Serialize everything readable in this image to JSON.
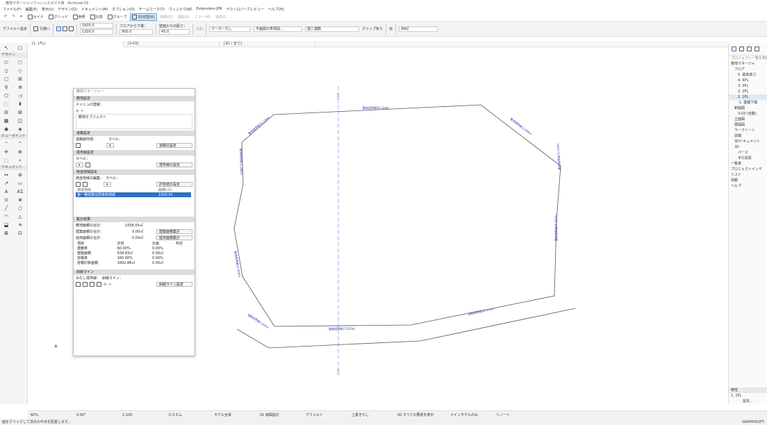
{
  "window": {
    "title": "敷地マネージャリファレンスガイド用 - Archicad 29"
  },
  "menu": [
    "ファイル(F)",
    "編集(E)",
    "表示(V)",
    "デザイン(D)",
    "ドキュメント(M)",
    "オプション(O)",
    "チームワーク(T)",
    "ウィンドウ(W)",
    "Extensions JPN",
    "テクノロジープレビュー",
    "ヘルプ(H)"
  ],
  "toolbar": {
    "guide": "ガイド",
    "grid": "グリッド",
    "ref": "参照",
    "calc": "計測",
    "group": "グループ",
    "view_mode": "3D切替(K)",
    "move": "移動(D)",
    "rotate": "回転(R)",
    "mirror": "ミラー(M)",
    "recall": "逆順ダ...",
    "items": [
      "↶",
      "↷",
      "✦"
    ]
  },
  "infobox": {
    "default": "デフォルト設定",
    "draw": "引渡い",
    "h1": "1600.0",
    "h2": "1200.0",
    "floor_from": "フロアから下端：",
    "floor_val": "900.0",
    "wall_from": "壁面からの距さ：",
    "wall_val": "45.0",
    "reverse": "反転",
    "marker": "マーカーなし",
    "plane": "平面図の表現図...",
    "wall_link": "壁に連動",
    "clip": "クリップ有り",
    "glass": "窓",
    "aw": "AW2"
  },
  "tabs": [
    "[1. 1FL]",
    "[3-03]",
    "[3D / 全て]"
  ],
  "toolbox": {
    "section_design": "デザイン",
    "section_viewpoint": "ビューポイント",
    "section_document": "ドキュメント",
    "design_icons": [
      "⬭",
      "⬡",
      "▯",
      "◇",
      "▢",
      "⊞",
      "⚲",
      "✲",
      "⬠",
      "◁",
      "⬚",
      "⬍",
      "⊟",
      "⊞",
      "▦",
      "◫",
      "◉",
      "◈"
    ],
    "viewpoint_icons": [
      "⌃",
      "⌃",
      "✢",
      "⊕",
      "⬚",
      "⌕"
    ],
    "document_icons": [
      "↔",
      "⊛",
      "↗",
      "▭",
      "A",
      "A1",
      "⊙",
      "⊗",
      "╱",
      "○",
      "◠",
      "△",
      "⬓",
      "✳",
      "⊠",
      "⊡"
    ]
  },
  "right_panel": {
    "project_label": "プロジェクト一覧を検索",
    "items": [
      "敷地マネージャ",
      "フロア",
      "5. 最高高さ",
      "4. RFL",
      "3. 3FL",
      "2. 2FL",
      "1. 1FL",
      "-1. 基礎下端",
      "断面図",
      "3-03 (自動)",
      "立面図",
      "展開図",
      "ワークシート",
      "詳細",
      "3Dドキュメント",
      "3D",
      "パース",
      "平行投影",
      "一覧表",
      "プロジェクトインデ",
      "リスト",
      "情報",
      "ヘルプ"
    ],
    "selected_index": 6,
    "bottom_floor": "1.  1FL",
    "settings": "設定...",
    "properties": "特性"
  },
  "palette": {
    "title": "敷地マネージャー",
    "s_site": "敷地設定",
    "mesh_label": "メッシュの登録：",
    "site_object": "敷地オブジェクト",
    "s_road": "道路設定",
    "road_create": "道路線作成：",
    "label_text": "ラベル：",
    "road_settings": "道路の設定",
    "s_boundary": "境界線設定",
    "boundary_settings": "境界線の設定",
    "s_zone": "用途地域設定",
    "zone_edit": "用途地域の編集：",
    "permit_settings": "許容値の設定",
    "zone_cols": [
      "用途地域",
      "面積(㎡)"
    ],
    "zone_row": [
      "第一種低層住居専用地域",
      "1058.05"
    ],
    "s_calc": "集計結果",
    "site_area_label": "敷地面積の合計：",
    "site_area": "1058.05㎡",
    "building_area_label": "建築面積の合計：",
    "building_area": "0.00㎡",
    "building_area_btn": "建築面積集計",
    "floor_area_label": "延床面積の合計：",
    "floor_area": "0.00㎡",
    "floor_area_btn": "延床面積集計",
    "table_head": [
      "項目",
      "許容",
      "計画",
      "判定"
    ],
    "table_rows": [
      [
        "建蔽率",
        "60.00%",
        "0.00%",
        ""
      ],
      [
        "建築面積",
        "634.83㎡",
        "0.00㎡",
        ""
      ],
      [
        "容積率",
        "160.00%",
        "0.00%",
        ""
      ],
      [
        "容積対象面積",
        "1692.88㎡",
        "0.00㎡",
        ""
      ]
    ],
    "s_slant": "斜線ライン",
    "slant_bound": "みなし境界線：",
    "slant_line": "斜線ライン：",
    "slant_settings": "斜線ライン設定"
  },
  "drawing": {
    "labels": [
      "敷地境界線26.314m",
      "敷地境界線11.600m",
      "敷地境界線14.120m",
      "敷地境界線12.286m",
      "敷地境界線11.524m",
      "敷地境界線16.194m",
      "敷地境界線21.600m",
      "道路境界線17.023m",
      "道路境界線16.371m",
      "道路境界線4.204m"
    ],
    "section_top": "3-03",
    "section_bot": "3-03"
  },
  "statusbar": {
    "items": [
      "60%",
      "0.00°",
      "1:100",
      "カスタム",
      "モデル全体",
      "01 線図設計",
      "デフォルト",
      "上書きなし",
      "00 すべての要素を表示",
      "メインモデルのみ",
      "リノート"
    ]
  },
  "hint": "面をクリックして頂点の中点を配置します。",
  "brand": "GRAPHISOFT"
}
